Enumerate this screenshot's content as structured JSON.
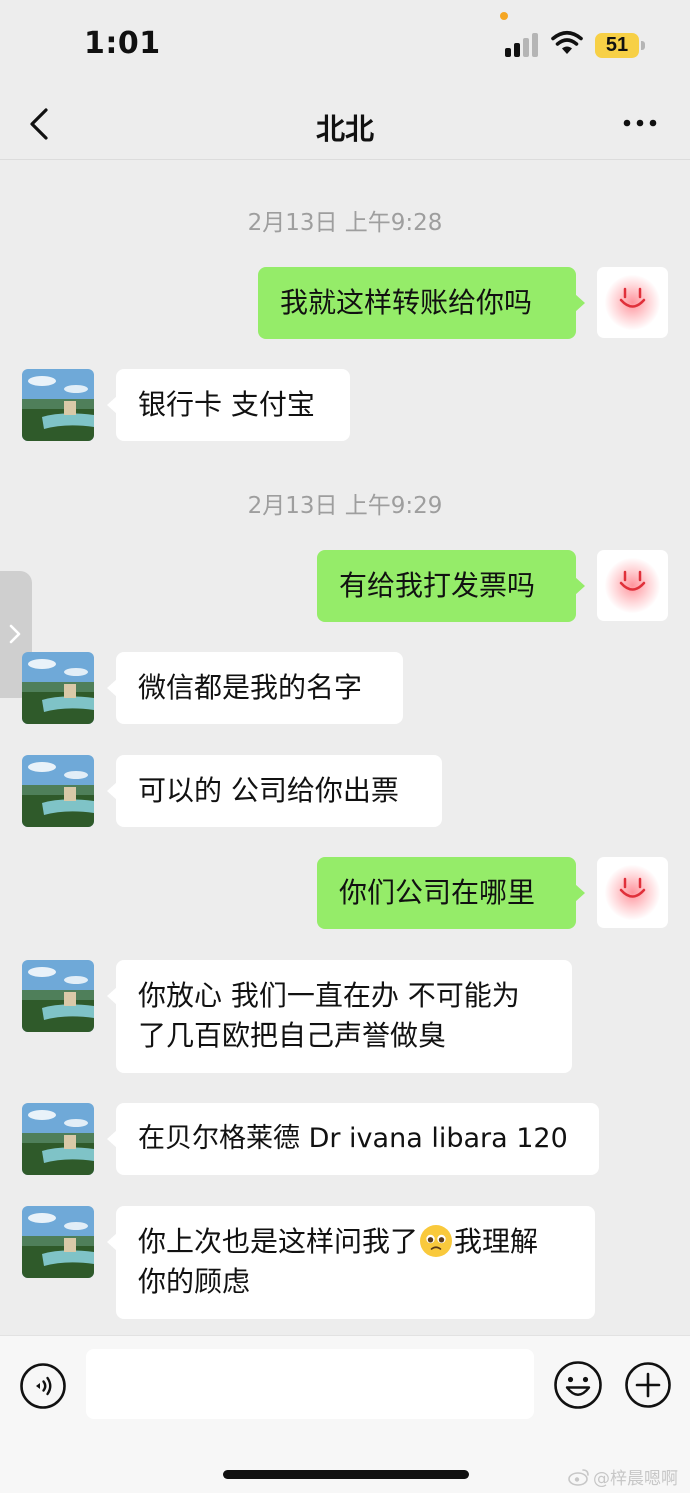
{
  "status_bar": {
    "time": "1:01",
    "battery": "51",
    "icons": [
      "signal-icon",
      "wifi-icon",
      "battery-icon"
    ]
  },
  "nav": {
    "title": "北北",
    "back_icon": "chevron-left-icon",
    "more_icon": "more-icon"
  },
  "messages": {
    "ts1": "2月13日 上午9:28",
    "m1": "我就这样转账给你吗",
    "m2": "银行卡 支付宝",
    "ts2": "2月13日 上午9:29",
    "m3": "有给我打发票吗",
    "m4": "微信都是我的名字",
    "m5": "可以的 公司给你出票",
    "m6": "你们公司在哪里",
    "m7_line1": "你放心 我们一直在办 不可能为",
    "m7_line2": "了几百欧把自己声誉做臭",
    "m8": "在贝尔格莱德 Dr ivana libara 120",
    "m9_a": "你上次也是这样问我了",
    "m9_b": "我理解",
    "m9_line2": "你的顾虑"
  },
  "input_bar": {
    "placeholder": "",
    "icons": [
      "voice-icon",
      "emoji-icon",
      "plus-icon"
    ]
  },
  "watermark": "@梓晨嗯啊",
  "colors": {
    "background": "#ededed",
    "my_bubble": "#95ec69",
    "their_bubble": "#ffffff",
    "battery": "#f7d046"
  }
}
